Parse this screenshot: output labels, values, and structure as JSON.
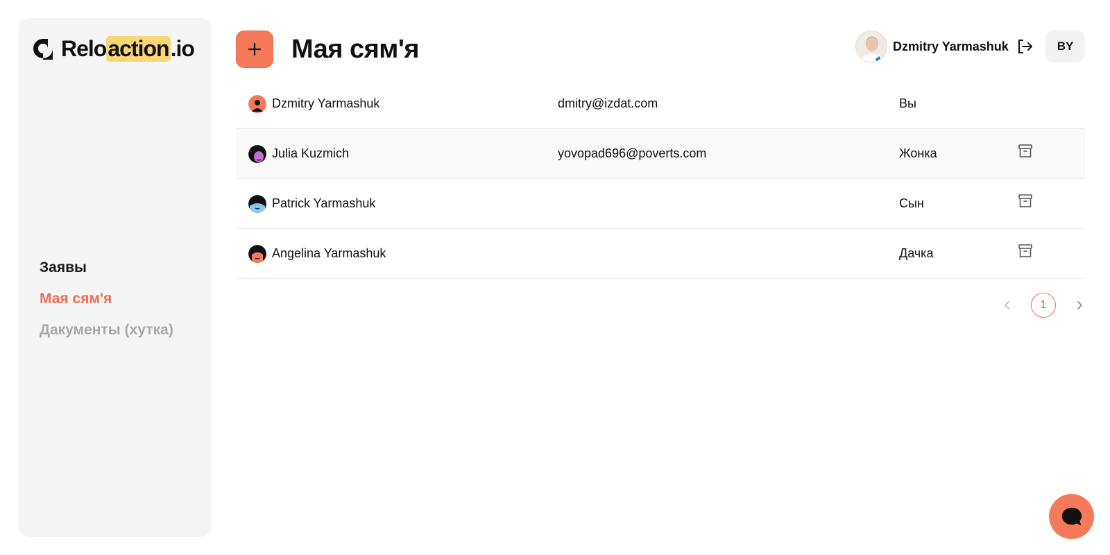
{
  "brand": {
    "name_part1": "Relo",
    "name_highlight": "action",
    "name_part2": ".io"
  },
  "sidebar": {
    "items": [
      {
        "label": "Заявы"
      },
      {
        "label": "Мая сям'я"
      },
      {
        "label": "Дакументы (хутка)"
      }
    ]
  },
  "header": {
    "title": "Мая сям'я",
    "add_icon": "plus-icon",
    "user_name": "Dzmitry Yarmashuk",
    "logout_icon": "logout-icon",
    "lang": "BY"
  },
  "members": [
    {
      "name": "Dzmitry Yarmashuk",
      "email": "dmitry@izdat.com",
      "role": "Вы",
      "archivable": false
    },
    {
      "name": "Julia Kuzmich",
      "email": "yovopad696@poverts.com",
      "role": "Жонка",
      "archivable": true
    },
    {
      "name": "Patrick Yarmashuk",
      "email": "",
      "role": "Сын",
      "archivable": true
    },
    {
      "name": "Angelina Yarmashuk",
      "email": "",
      "role": "Дачка",
      "archivable": true
    }
  ],
  "pagination": {
    "current": "1"
  },
  "colors": {
    "accent": "#f26c4f",
    "button": "#f47a5a",
    "logo_highlight": "#f7d774",
    "sidebar_bg": "#f5f5f5"
  }
}
